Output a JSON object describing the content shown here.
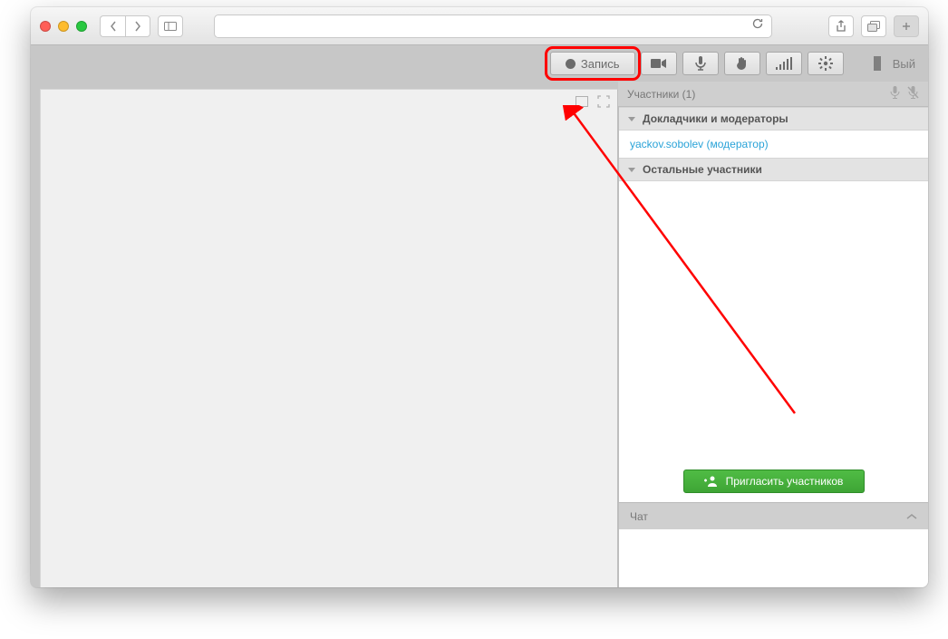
{
  "toolbar": {
    "record_label": "Запись",
    "exit_label": "Вый"
  },
  "participants": {
    "header": "Участники (1)",
    "section_speakers": "Докладчики и модераторы",
    "section_others": "Остальные участники",
    "user": "yackov.sobolev (модератор)",
    "invite_label": "Пригласить участников"
  },
  "chat": {
    "header": "Чат"
  }
}
